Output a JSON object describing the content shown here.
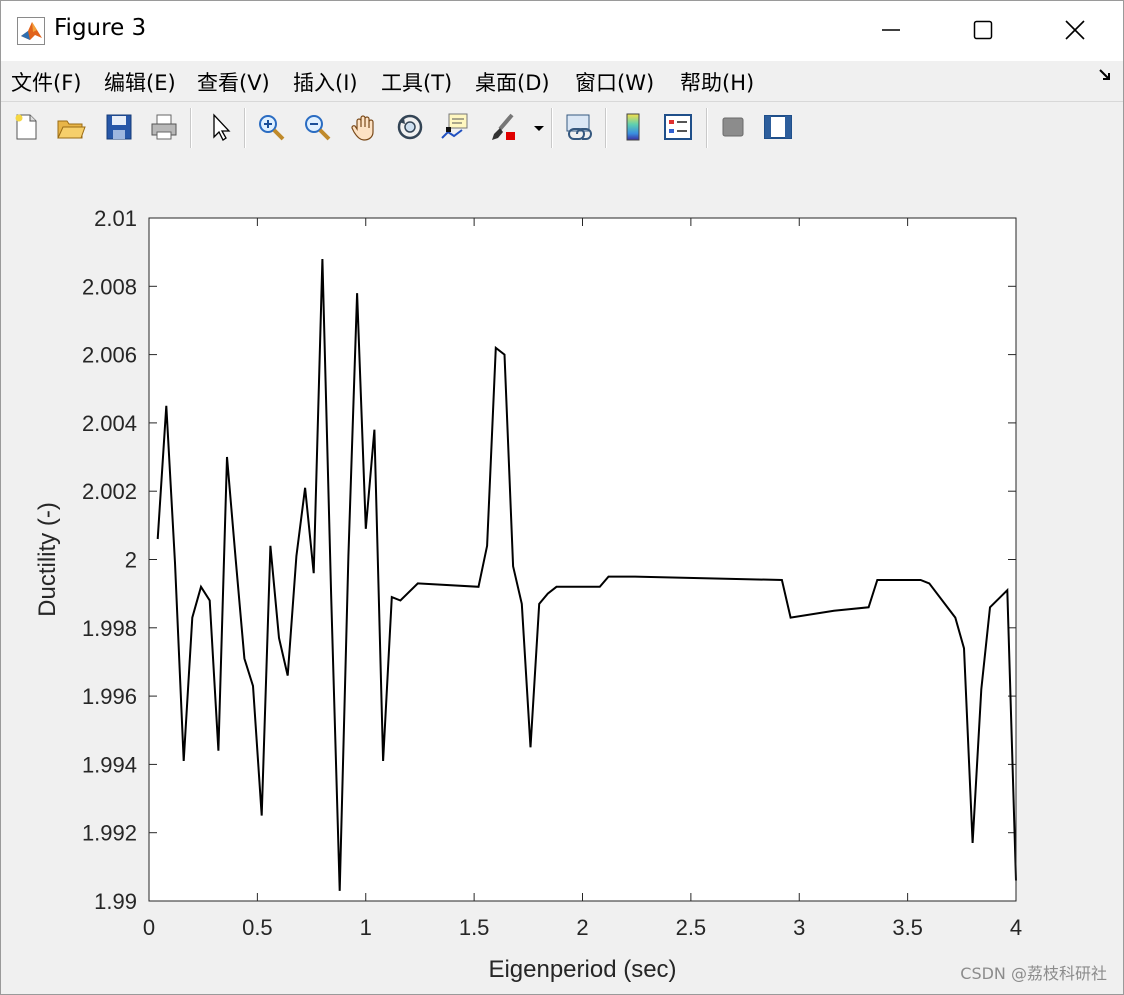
{
  "window": {
    "title": "Figure 3",
    "controls": [
      "minimize",
      "maximize",
      "close"
    ]
  },
  "menu": [
    "文件(F)",
    "编辑(E)",
    "查看(V)",
    "插入(I)",
    "工具(T)",
    "桌面(D)",
    "窗口(W)",
    "帮助(H)"
  ],
  "toolbar": {
    "buttons": [
      "new-figure-icon",
      "open-file-icon",
      "save-icon",
      "print-icon",
      "select-arrow-icon",
      "zoom-in-icon",
      "zoom-out-icon",
      "pan-hand-icon",
      "rotate-3d-icon",
      "data-cursor-icon",
      "brush-icon",
      "brush-dropdown-icon",
      "link-plot-icon",
      "colorbar-icon",
      "legend-icon",
      "hide-plot-tools-icon",
      "show-plot-tools-icon"
    ]
  },
  "chart_data": {
    "type": "line",
    "xlabel": "Eigenperiod (sec)",
    "ylabel": "Ductility (-)",
    "xlim": [
      0,
      4
    ],
    "ylim": [
      1.99,
      2.01
    ],
    "xticks": [
      "0",
      "0.5",
      "1",
      "1.5",
      "2",
      "2.5",
      "3",
      "3.5",
      "4"
    ],
    "yticks": [
      "1.99",
      "1.992",
      "1.994",
      "1.996",
      "1.998",
      "2",
      "2.002",
      "2.004",
      "2.006",
      "2.008",
      "2.01"
    ],
    "line_color": "#000000",
    "grid": false,
    "x": [
      0.04,
      0.08,
      0.12,
      0.16,
      0.2,
      0.24,
      0.28,
      0.32,
      0.36,
      0.4,
      0.44,
      0.48,
      0.52,
      0.56,
      0.6,
      0.64,
      0.68,
      0.72,
      0.76,
      0.8,
      0.84,
      0.88,
      0.92,
      0.96,
      1.0,
      1.04,
      1.08,
      1.12,
      1.16,
      1.24,
      1.52,
      1.56,
      1.6,
      1.64,
      1.68,
      1.72,
      1.76,
      1.8,
      1.84,
      1.88,
      2.08,
      2.12,
      2.24,
      2.92,
      2.96,
      3.16,
      3.32,
      3.36,
      3.56,
      3.6,
      3.72,
      3.76,
      3.8,
      3.84,
      3.88,
      3.96,
      4.0
    ],
    "y": [
      2.0006,
      2.0045,
      1.9999,
      1.9941,
      1.9983,
      1.9992,
      1.9988,
      1.9944,
      2.003,
      2.0,
      1.9971,
      1.9963,
      1.9925,
      2.0004,
      1.9977,
      1.9966,
      2.0001,
      2.0021,
      1.9996,
      2.0088,
      1.999,
      1.9903,
      2.0001,
      2.0078,
      2.0009,
      2.0038,
      1.9941,
      1.9989,
      1.9988,
      1.9993,
      1.9992,
      2.0004,
      2.0062,
      2.006,
      1.9998,
      1.9987,
      1.9945,
      1.9987,
      1.999,
      1.9992,
      1.9992,
      1.9995,
      1.9995,
      1.9994,
      1.9983,
      1.9985,
      1.9986,
      1.9994,
      1.9994,
      1.9993,
      1.9983,
      1.9974,
      1.9917,
      1.9962,
      1.9986,
      1.9991,
      1.9906
    ]
  },
  "watermark": "CSDN @荔枝科研社"
}
